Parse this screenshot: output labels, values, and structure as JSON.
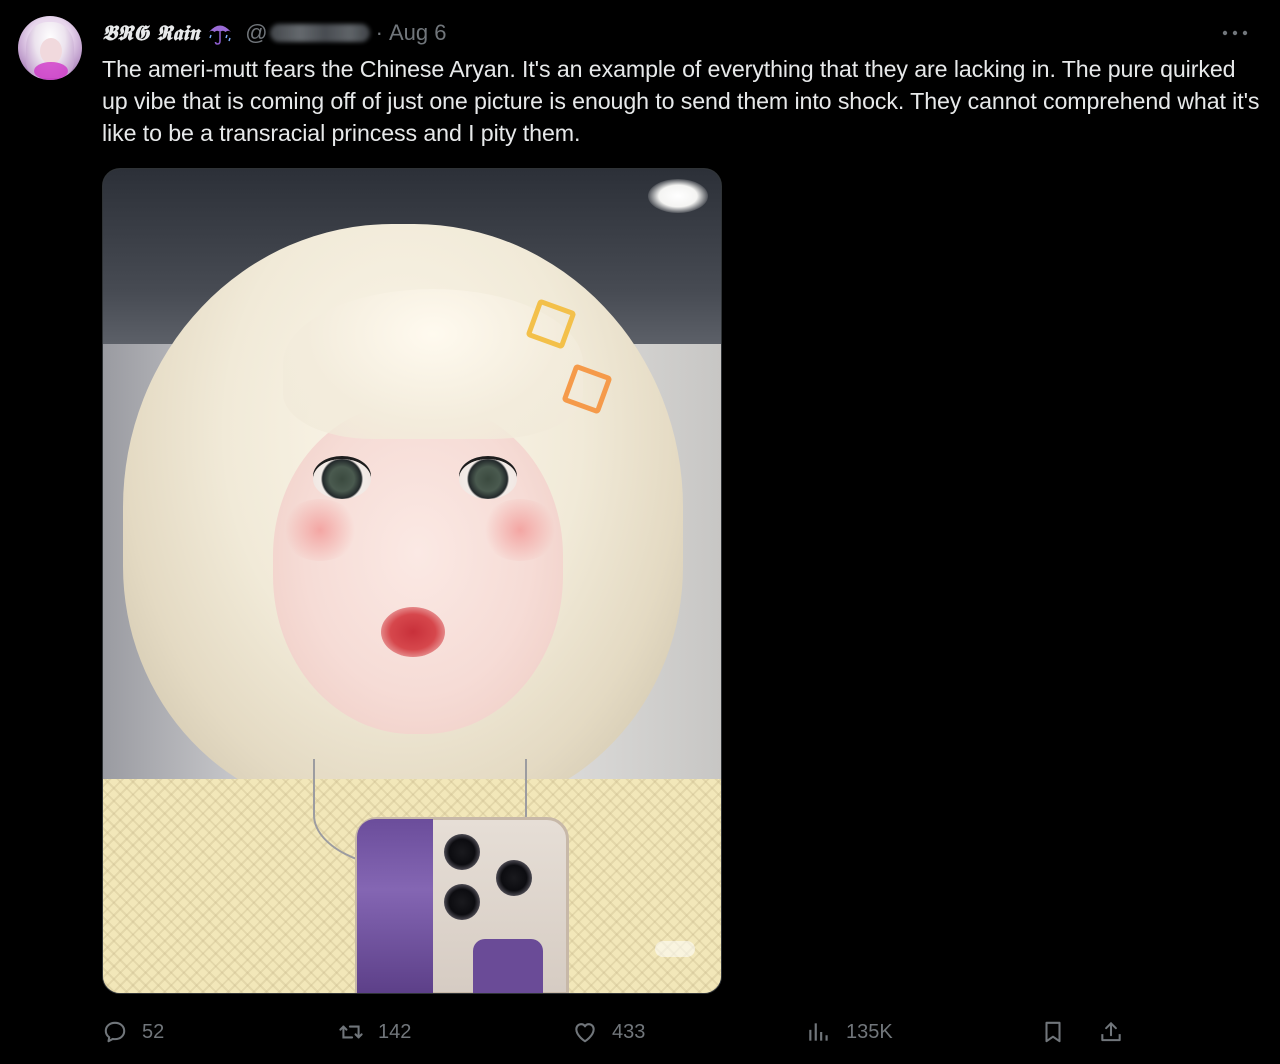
{
  "author": {
    "display_name": "𝕭𝕽𝕲 𝕽𝖆𝖎𝖓",
    "handle_prefix": "@",
    "separator": "·",
    "timestamp": "Aug 6"
  },
  "tweet": {
    "text": "The ameri-mutt fears the Chinese Aryan. It's an example of everything that they are lacking in. The pure quirked up vibe that is coming off of just one picture is enough to send them into shock. They cannot comprehend what it's like to be a transracial princess and I pity them."
  },
  "actions": {
    "replies": "52",
    "retweets": "142",
    "likes": "433",
    "views": "135K"
  },
  "icons": {
    "name_emoji": "umbrella-with-rain-icon",
    "more": "more-dots-icon",
    "reply": "reply-bubble-icon",
    "retweet": "retweet-icon",
    "like": "heart-icon",
    "views": "views-bars-icon",
    "bookmark": "bookmark-icon",
    "share": "share-upload-icon"
  },
  "colors": {
    "background": "#000000",
    "text_primary": "#e7e9ea",
    "text_secondary": "#71767b",
    "border": "#2f3336"
  }
}
